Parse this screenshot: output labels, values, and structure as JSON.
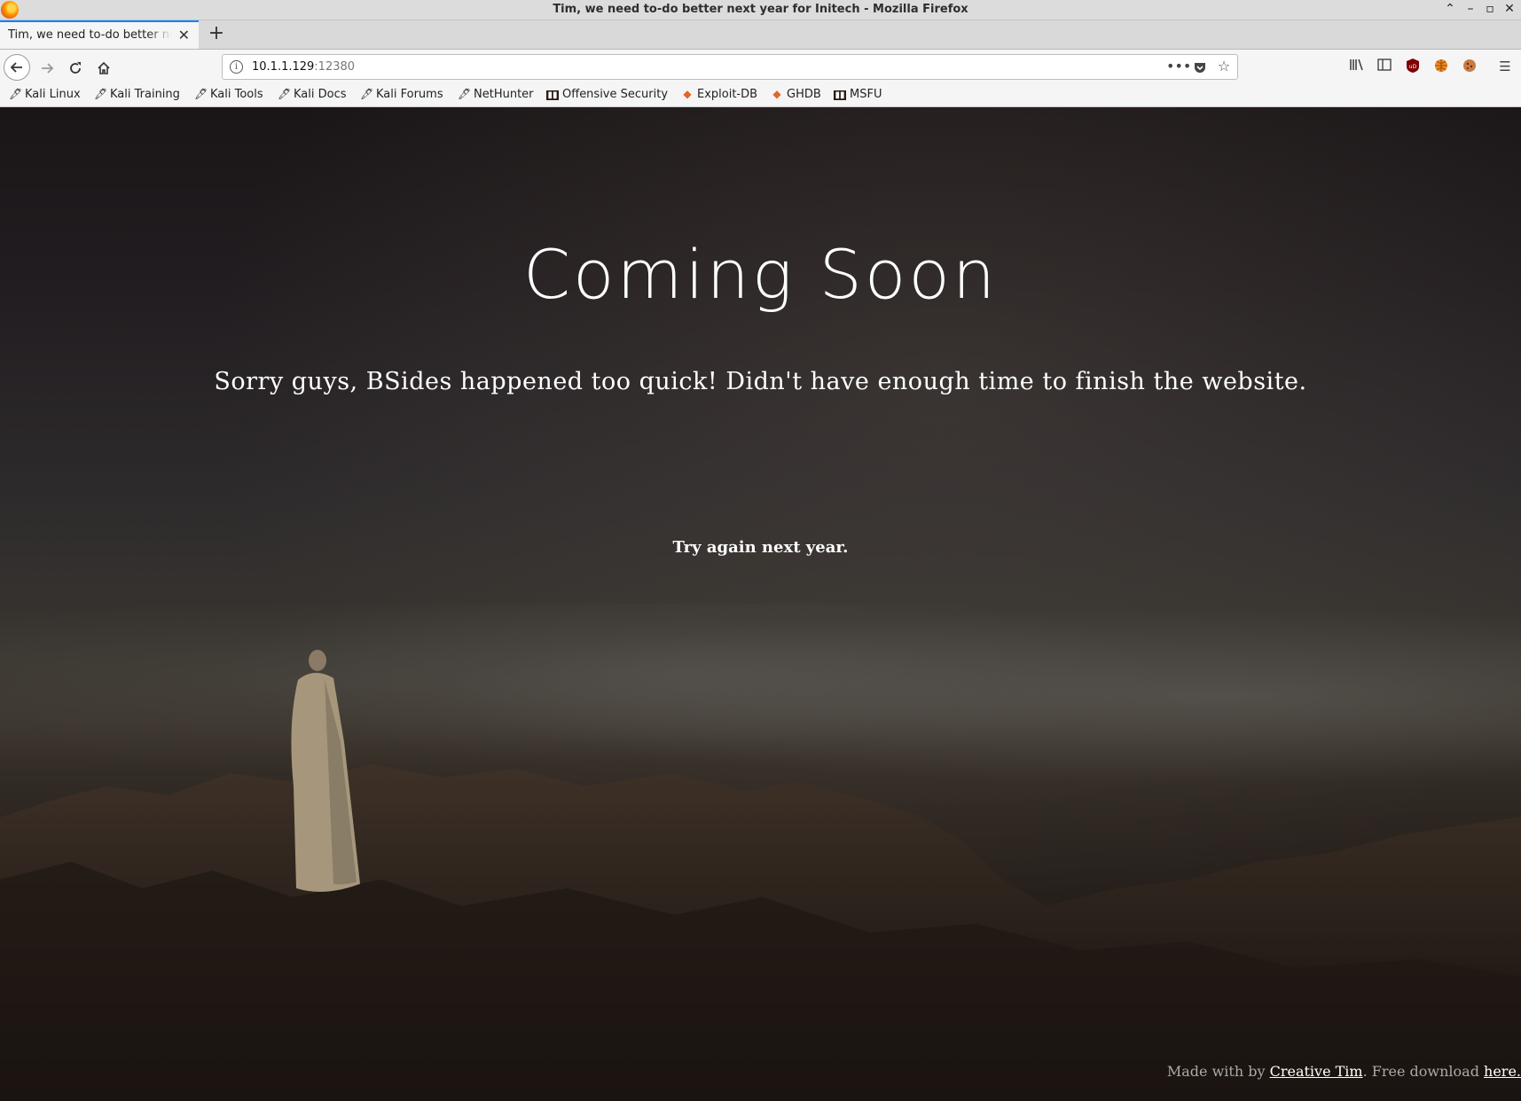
{
  "window": {
    "title": "Tim, we need to-do better next year for Initech - Mozilla Firefox",
    "controls": [
      "⌃",
      "–",
      "▫",
      "✕"
    ]
  },
  "tabs": [
    {
      "label": "Tim, we need to-do better next year for Initech",
      "active": true
    }
  ],
  "toolbar": {
    "url_host": "10.1.1.129",
    "url_port": ":12380"
  },
  "bookmarks": [
    {
      "label": "Kali Linux",
      "icon": "kali-dragon-icon"
    },
    {
      "label": "Kali Training",
      "icon": "kali-dragon-icon"
    },
    {
      "label": "Kali Tools",
      "icon": "kali-dragon-icon"
    },
    {
      "label": "Kali Docs",
      "icon": "kali-dragon-icon"
    },
    {
      "label": "Kali Forums",
      "icon": "kali-dragon-icon"
    },
    {
      "label": "NetHunter",
      "icon": "kali-dragon-icon"
    },
    {
      "label": "Offensive Security",
      "icon": "offsec-icon"
    },
    {
      "label": "Exploit-DB",
      "icon": "exploitdb-icon"
    },
    {
      "label": "GHDB",
      "icon": "exploitdb-icon"
    },
    {
      "label": "MSFU",
      "icon": "offsec-icon"
    }
  ],
  "page": {
    "headline": "Coming Soon",
    "subline": "Sorry guys, BSides happened too quick! Didn't have enough time to finish the website.",
    "tagline": "Try again next year.",
    "footer": {
      "prefix": "Made with by ",
      "link1": "Creative Tim",
      "middle": ". Free download ",
      "link2": "here."
    }
  },
  "colors": {
    "accent": "#0a84ff",
    "page_text": "#ffffff"
  }
}
